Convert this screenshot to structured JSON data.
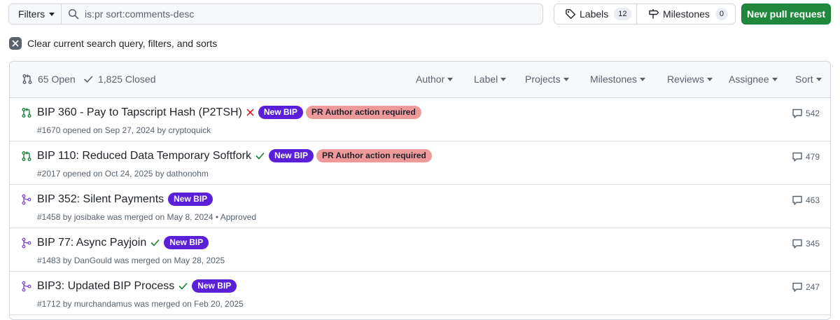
{
  "toolbar": {
    "filters_label": "Filters",
    "search_value": "is:pr sort:comments-desc",
    "labels_label": "Labels",
    "labels_count": "12",
    "milestones_label": "Milestones",
    "milestones_count": "0",
    "new_pr_label": "New pull request"
  },
  "clear_filters_label": "Clear current search query, filters, and sorts",
  "list_header": {
    "open_label": "65 Open",
    "closed_label": "1,825 Closed",
    "menus": [
      "Author",
      "Label",
      "Projects",
      "Milestones",
      "Reviews",
      "Assignee",
      "Sort"
    ]
  },
  "pull_requests": [
    {
      "state": "open",
      "title": "BIP 360 - Pay to Tapscript Hash (P2TSH)",
      "check_status": "failure",
      "labels": [
        "New BIP",
        "PR Author action required"
      ],
      "meta": "#1670 opened on Sep 27, 2024 by cryptoquick",
      "comments": "542"
    },
    {
      "state": "open",
      "title": "BIP 110: Reduced Data Temporary Softfork",
      "check_status": "success",
      "labels": [
        "New BIP",
        "PR Author action required"
      ],
      "meta": "#2017 opened on Oct 24, 2025 by dathonohm",
      "comments": "479"
    },
    {
      "state": "merged",
      "title": "BIP 352: Silent Payments",
      "check_status": "none",
      "labels": [
        "New BIP"
      ],
      "meta": "#1458 by josibake was merged on May 8, 2024 • Approved",
      "comments": "463"
    },
    {
      "state": "merged",
      "title": "BIP 77: Async Payjoin",
      "check_status": "success",
      "labels": [
        "New BIP"
      ],
      "meta": "#1483 by DanGould was merged on May 28, 2025",
      "comments": "345"
    },
    {
      "state": "merged",
      "title": "BIP3: Updated BIP Process",
      "check_status": "success",
      "labels": [
        "New BIP"
      ],
      "meta": "#1712 by murchandamus was merged on Feb 20, 2025",
      "comments": "247"
    }
  ],
  "colors": {
    "open_green": "#1a7f37",
    "merged_purple": "#8250df",
    "check_green": "#1a7f37",
    "fail_red": "#d1242f",
    "new_bip_label": "#5a1fd6",
    "action_required_label": "#ef9a9a",
    "primary_button": "#1f883d"
  },
  "icons": {
    "search": "search-icon",
    "labels": "tag-icon",
    "milestones": "milestone-icon",
    "open_pr": "git-pull-request-icon",
    "merged_pr": "git-merge-icon",
    "closed": "check-icon",
    "comment": "comment-icon",
    "clear": "x-icon"
  }
}
